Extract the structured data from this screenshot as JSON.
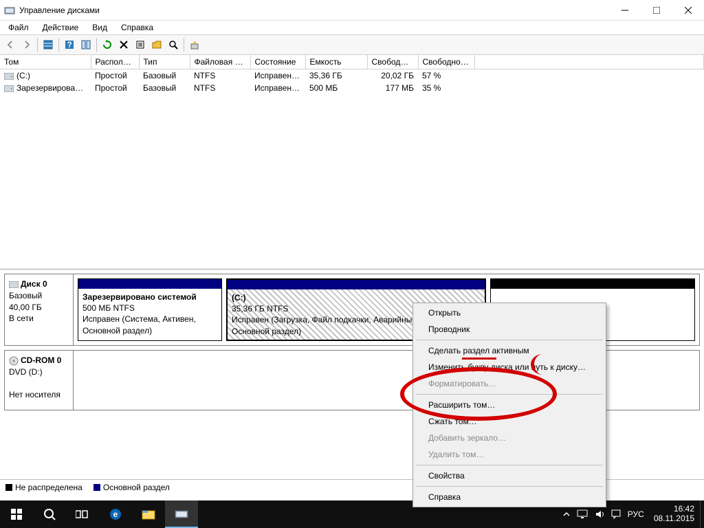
{
  "window": {
    "title": "Управление дисками"
  },
  "menu": {
    "file": "Файл",
    "action": "Действие",
    "view": "Вид",
    "help": "Справка"
  },
  "columns": [
    "Том",
    "Распол…",
    "Тип",
    "Файловая с…",
    "Состояние",
    "Емкость",
    "Свобод…",
    "Свободно %"
  ],
  "volumes": [
    {
      "name": "(C:)",
      "layout": "Простой",
      "type": "Базовый",
      "fs": "NTFS",
      "state": "Исправен…",
      "cap": "35,36 ГБ",
      "free": "20,02 ГБ",
      "pct": "57 %"
    },
    {
      "name": "Зарезервировано…",
      "layout": "Простой",
      "type": "Базовый",
      "fs": "NTFS",
      "state": "Исправен…",
      "cap": "500 МБ",
      "free": "177 МБ",
      "pct": "35 %"
    }
  ],
  "disk0": {
    "label": "Диск 0",
    "type": "Базовый",
    "size": "40,00 ГБ",
    "status": "В сети",
    "p0": {
      "title": "Зарезервировано системой",
      "line2": "500 МБ NTFS",
      "line3": "Исправен (Система, Активен, Основной раздел)"
    },
    "p1": {
      "title": "(C:)",
      "line2": "35,36 ГБ NTFS",
      "line3": "Исправен (Загрузка, Файл подкачки, Аварийный дамп, Основной раздел)"
    }
  },
  "cdrom": {
    "label": "CD-ROM 0",
    "dev": "DVD (D:)",
    "status": "Нет носителя"
  },
  "legend": {
    "unalloc": "Не распределена",
    "primary": "Основной раздел"
  },
  "ctx": {
    "open": "Открыть",
    "explorer": "Проводник",
    "active": "Сделать раздел активным",
    "chletter": "Изменить букву диска или путь к диску…",
    "format": "Форматировать…",
    "extend": "Расширить том…",
    "shrink": "Сжать том…",
    "mirror": "Добавить зеркало…",
    "delete": "Удалить том…",
    "props": "Свойства",
    "chelp": "Справка"
  },
  "taskbar": {
    "lang": "РУС",
    "time": "16:42",
    "date": "08.11.2015"
  }
}
